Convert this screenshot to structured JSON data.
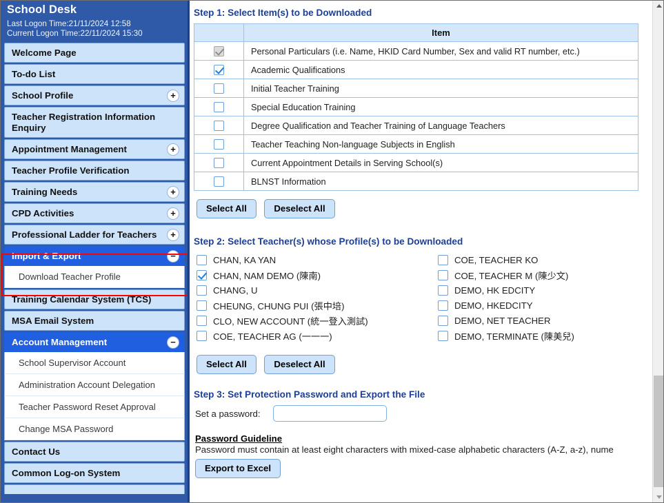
{
  "sidebar": {
    "title": "School Desk",
    "last_logon": "Last Logon Time:21/11/2024 12:58",
    "current_logon": "Current Logon Time:22/11/2024 15:30",
    "items": [
      {
        "label": "Welcome Page",
        "toggle": "",
        "state": "normal"
      },
      {
        "label": "To-do List",
        "toggle": "",
        "state": "normal"
      },
      {
        "label": "School Profile",
        "toggle": "+",
        "state": "normal"
      },
      {
        "label": "Teacher Registration Information Enquiry",
        "toggle": "",
        "state": "normal"
      },
      {
        "label": "Appointment Management",
        "toggle": "+",
        "state": "normal"
      },
      {
        "label": "Teacher Profile Verification",
        "toggle": "",
        "state": "normal"
      },
      {
        "label": "Training Needs",
        "toggle": "+",
        "state": "normal"
      },
      {
        "label": "CPD Activities",
        "toggle": "+",
        "state": "normal"
      },
      {
        "label": "Professional Ladder for Teachers",
        "toggle": "+",
        "state": "normal"
      }
    ],
    "import_export": {
      "label": "Import & Export",
      "toggle": "−",
      "sub_items": [
        "Download Teacher Profile"
      ]
    },
    "items2": [
      {
        "label": "Training Calendar System (TCS)",
        "toggle": "",
        "state": "normal"
      },
      {
        "label": "MSA Email System",
        "toggle": "",
        "state": "normal"
      }
    ],
    "account_management": {
      "label": "Account Management",
      "toggle": "−",
      "sub_items": [
        "School Supervisor Account",
        "Administration Account Delegation",
        "Teacher Password Reset Approval",
        "Change MSA Password"
      ]
    },
    "items3": [
      {
        "label": "Contact Us",
        "toggle": "",
        "state": "normal"
      },
      {
        "label": "Common Log-on System",
        "toggle": "",
        "state": "normal"
      }
    ]
  },
  "main": {
    "step1": {
      "title": "Step 1: Select Item(s) to be Downloaded",
      "table": {
        "headers": [
          "",
          "Item"
        ],
        "rows": [
          {
            "label": "Personal Particulars (i.e. Name, HKID Card Number, Sex and valid RT number, etc.)",
            "checked": true,
            "disabled": true
          },
          {
            "label": "Academic Qualifications",
            "checked": true,
            "disabled": false
          },
          {
            "label": "Initial Teacher Training",
            "checked": false,
            "disabled": false
          },
          {
            "label": "Special Education Training",
            "checked": false,
            "disabled": false
          },
          {
            "label": "Degree Qualification and Teacher Training of Language Teachers",
            "checked": false,
            "disabled": false
          },
          {
            "label": "Teacher Teaching Non-language Subjects in English",
            "checked": false,
            "disabled": false
          },
          {
            "label": "Current Appointment Details in Serving School(s)",
            "checked": false,
            "disabled": false
          },
          {
            "label": "BLNST Information",
            "checked": false,
            "disabled": false
          }
        ]
      },
      "select_all": "Select All",
      "deselect_all": "Deselect All"
    },
    "step2": {
      "title": "Step 2: Select Teacher(s) whose Profile(s) to be Downloaded",
      "column_left": [
        {
          "label": "CHAN, KA YAN",
          "checked": false
        },
        {
          "label": "CHAN, NAM DEMO (陳南)",
          "checked": true
        },
        {
          "label": "CHANG, U",
          "checked": false
        },
        {
          "label": "CHEUNG, CHUNG PUI (張中培)",
          "checked": false
        },
        {
          "label": "CLO, NEW ACCOUNT (統一登入測試)",
          "checked": false
        },
        {
          "label": "COE, TEACHER AG (一一一)",
          "checked": false
        }
      ],
      "column_right": [
        {
          "label": "COE, TEACHER KO",
          "checked": false
        },
        {
          "label": "COE, TEACHER M (陳少文)",
          "checked": false
        },
        {
          "label": "DEMO, HK EDCITY",
          "checked": false
        },
        {
          "label": "DEMO, HKEDCITY",
          "checked": false
        },
        {
          "label": "DEMO, NET TEACHER",
          "checked": false
        },
        {
          "label": "DEMO, TERMINATE (陳美兒)",
          "checked": false
        }
      ],
      "select_all": "Select All",
      "deselect_all": "Deselect All"
    },
    "step3": {
      "title": "Step 3: Set Protection Password and Export the File",
      "password_label": "Set a password:",
      "password_value": "",
      "password_placeholder": "",
      "guideline_title": "Password Guideline",
      "guideline_text": "Password must contain at least eight characters with mixed-case alphabetic characters (A-Z, a-z), nume",
      "export_button": "Export to Excel"
    }
  },
  "scrollbar": {
    "up_arrow": "scroll-up-arrow",
    "down_arrow": "scroll-down-arrow",
    "thumb": "scroll-thumb"
  },
  "colors": {
    "sidebar_bg": "#2f5aa8",
    "sidebar_item": "#cde3fa",
    "sidebar_active": "#1f5fe0",
    "step_title": "#1f3f94",
    "highlight_box": "#ff0000",
    "table_header": "#d4e7fb"
  }
}
